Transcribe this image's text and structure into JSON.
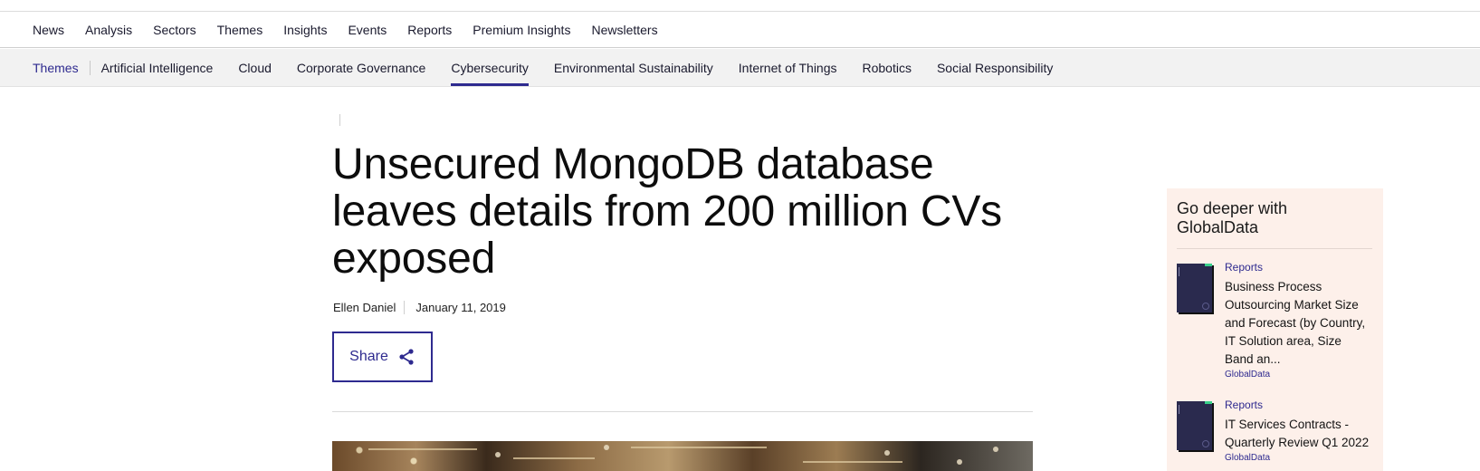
{
  "main_nav": {
    "items": [
      "News",
      "Analysis",
      "Sectors",
      "Themes",
      "Insights",
      "Events",
      "Reports",
      "Premium Insights",
      "Newsletters"
    ]
  },
  "sub_nav": {
    "section_label": "Themes",
    "items": [
      "Artificial Intelligence",
      "Cloud",
      "Corporate Governance",
      "Cybersecurity",
      "Environmental Sustainability",
      "Internet of Things",
      "Robotics",
      "Social Responsibility"
    ],
    "active": "Cybersecurity"
  },
  "article": {
    "title": "Unsecured MongoDB database leaves details from 200 million CVs exposed",
    "author": "Ellen Daniel",
    "date": "January 11, 2019",
    "share_label": "Share"
  },
  "sidebar": {
    "heading": "Go deeper with GlobalData",
    "reports": [
      {
        "category": "Reports",
        "title": "Business Process Outsourcing Market Size and Forecast (by Country, IT Solution area, Size Band an...",
        "source": "GlobalData"
      },
      {
        "category": "Reports",
        "title": "IT Services Contracts - Quarterly Review Q1 2022",
        "source": "GlobalData"
      }
    ]
  },
  "colors": {
    "accent": "#2e2a8f",
    "sidebar_bg": "#fdf0ea",
    "subnav_bg": "#f2f2f2"
  }
}
